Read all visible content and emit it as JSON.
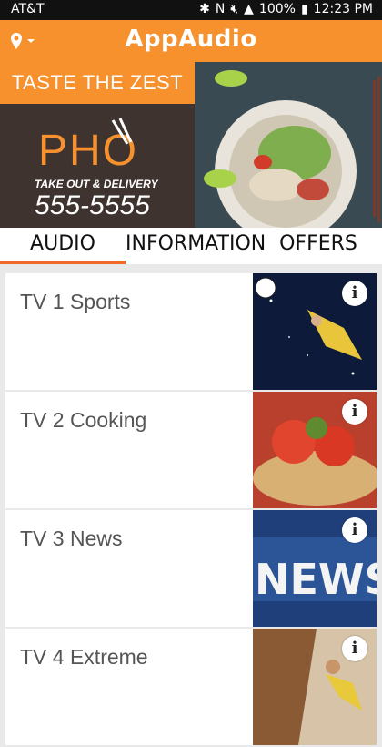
{
  "status": {
    "carrier": "AT&T",
    "battery": "100%",
    "time": "12:23 PM"
  },
  "app": {
    "title": "AppAudio"
  },
  "banner": {
    "tagline": "TASTE THE ZEST",
    "brand": "PHO",
    "service": "TAKE OUT & DELIVERY",
    "phone": "555-5555"
  },
  "tabs": [
    {
      "label": "AUDIO",
      "active": true
    },
    {
      "label": "INFORMATION",
      "active": false
    },
    {
      "label": "OFFERS",
      "active": false
    }
  ],
  "channels": [
    {
      "label": "TV 1 Sports",
      "image": "sports-image"
    },
    {
      "label": "TV 2 Cooking",
      "image": "cooking-image"
    },
    {
      "label": "TV 3 News",
      "image": "news-image"
    },
    {
      "label": "TV 4 Extreme",
      "image": "extreme-image"
    }
  ],
  "colors": {
    "accent": "#f6912d",
    "tab_underline": "#f26a2a"
  }
}
